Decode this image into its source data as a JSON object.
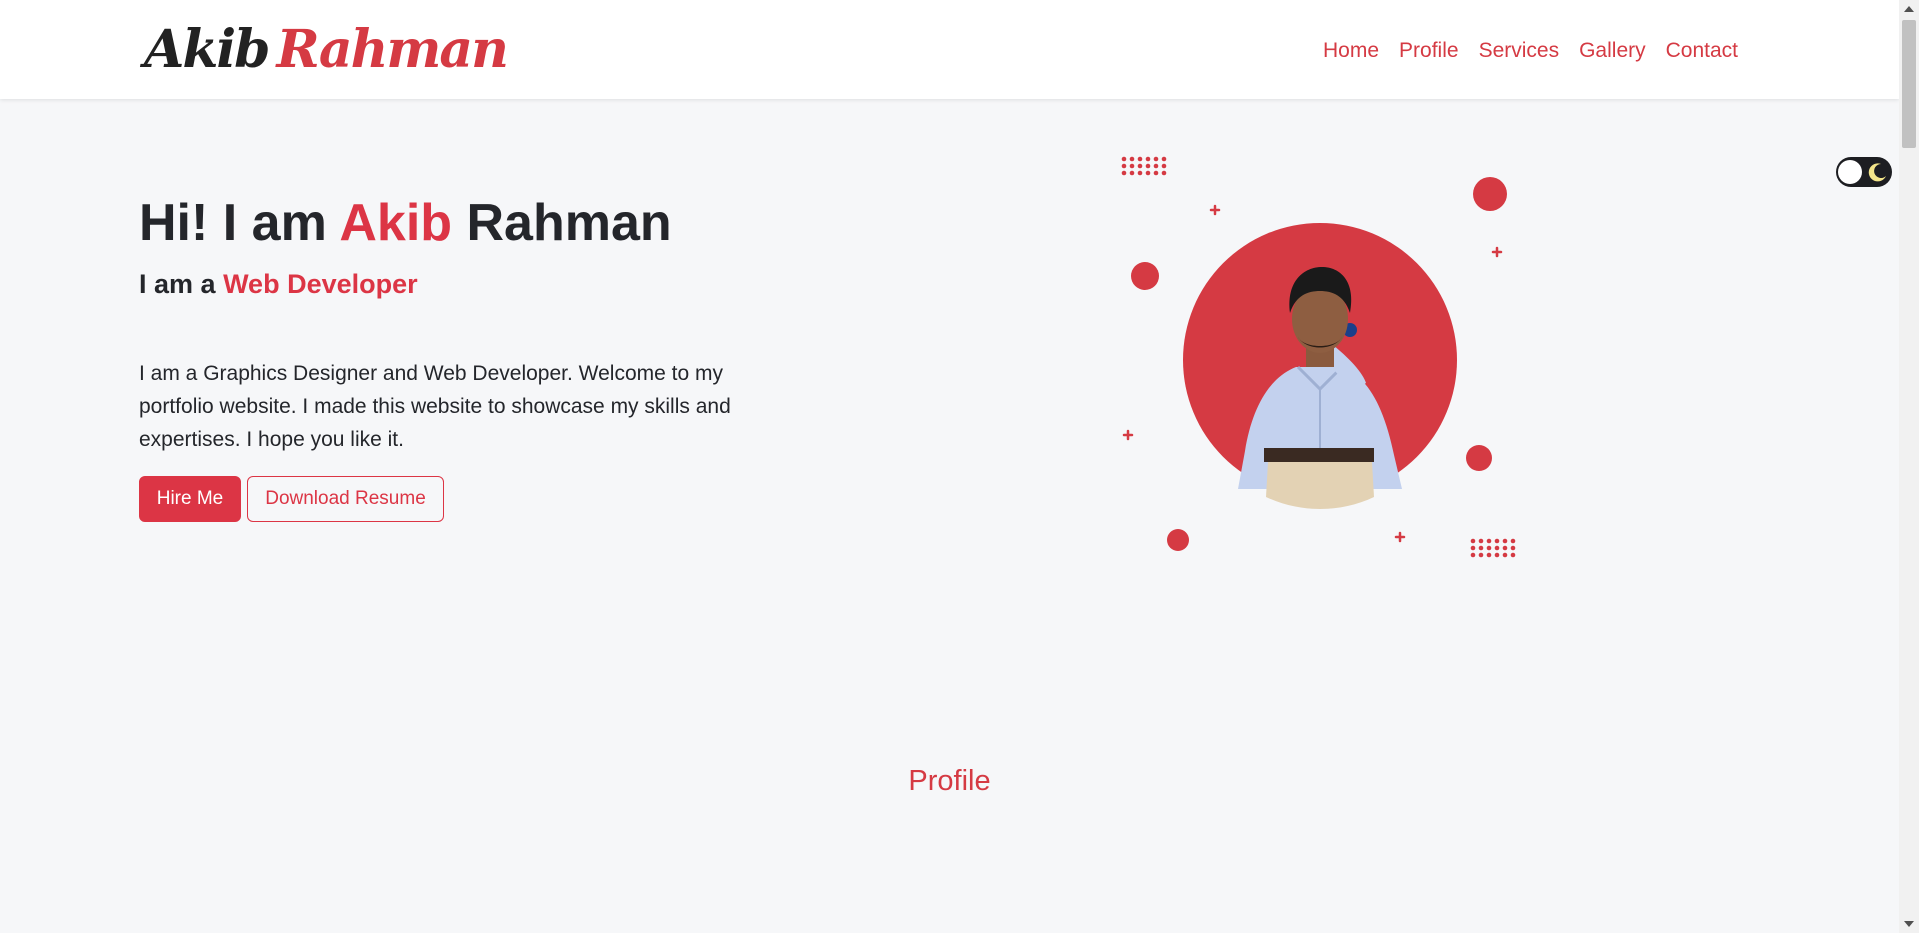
{
  "brand": {
    "first": "Akib",
    "last": "Rahman"
  },
  "nav": {
    "items": [
      {
        "label": "Home"
      },
      {
        "label": "Profile"
      },
      {
        "label": "Services"
      },
      {
        "label": "Gallery"
      },
      {
        "label": "Contact"
      }
    ]
  },
  "hero": {
    "title_prefix": "Hi! I am",
    "title_accent": "Akib",
    "title_suffix": "Rahman",
    "subtitle_prefix": "I am a",
    "subtitle_accent": "Web Developer",
    "description": "I am a Graphics Designer and Web Developer. Welcome to my portfolio website. I made this website to showcase my skills and expertises. I hope you like it.",
    "hire_label": "Hire Me",
    "resume_label": "Download Resume"
  },
  "profile_section": {
    "title": "Profile"
  },
  "theme_toggle": {
    "icons": [
      "circle-icon",
      "moon-icon"
    ]
  },
  "colors": {
    "accent": "#dc3545",
    "text": "#24262b",
    "background": "#f6f7f9",
    "navbar": "#ffffff"
  }
}
